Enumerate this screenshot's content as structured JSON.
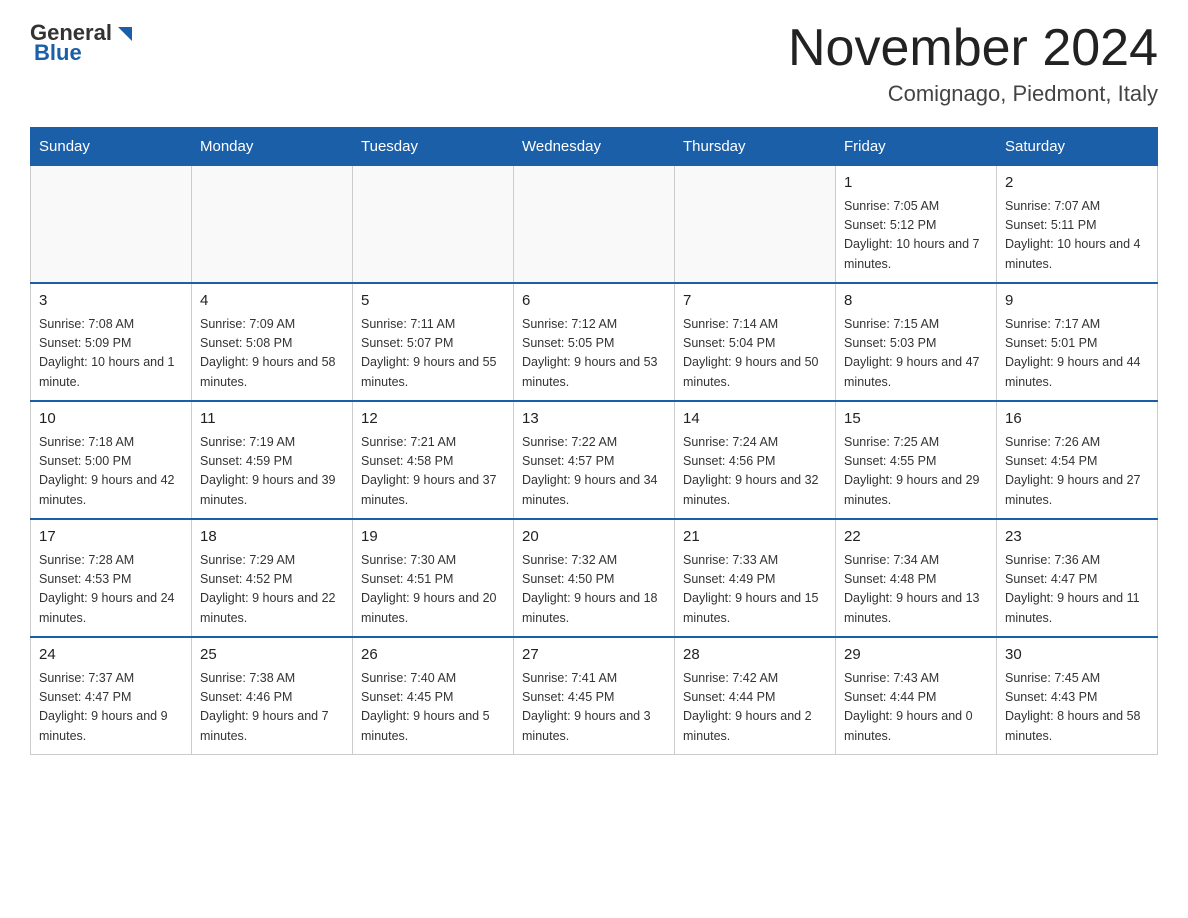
{
  "header": {
    "logo_general": "General",
    "logo_blue": "Blue",
    "month_title": "November 2024",
    "location": "Comignago, Piedmont, Italy"
  },
  "weekdays": [
    "Sunday",
    "Monday",
    "Tuesday",
    "Wednesday",
    "Thursday",
    "Friday",
    "Saturday"
  ],
  "weeks": [
    [
      {
        "day": "",
        "info": ""
      },
      {
        "day": "",
        "info": ""
      },
      {
        "day": "",
        "info": ""
      },
      {
        "day": "",
        "info": ""
      },
      {
        "day": "",
        "info": ""
      },
      {
        "day": "1",
        "info": "Sunrise: 7:05 AM\nSunset: 5:12 PM\nDaylight: 10 hours and 7 minutes."
      },
      {
        "day": "2",
        "info": "Sunrise: 7:07 AM\nSunset: 5:11 PM\nDaylight: 10 hours and 4 minutes."
      }
    ],
    [
      {
        "day": "3",
        "info": "Sunrise: 7:08 AM\nSunset: 5:09 PM\nDaylight: 10 hours and 1 minute."
      },
      {
        "day": "4",
        "info": "Sunrise: 7:09 AM\nSunset: 5:08 PM\nDaylight: 9 hours and 58 minutes."
      },
      {
        "day": "5",
        "info": "Sunrise: 7:11 AM\nSunset: 5:07 PM\nDaylight: 9 hours and 55 minutes."
      },
      {
        "day": "6",
        "info": "Sunrise: 7:12 AM\nSunset: 5:05 PM\nDaylight: 9 hours and 53 minutes."
      },
      {
        "day": "7",
        "info": "Sunrise: 7:14 AM\nSunset: 5:04 PM\nDaylight: 9 hours and 50 minutes."
      },
      {
        "day": "8",
        "info": "Sunrise: 7:15 AM\nSunset: 5:03 PM\nDaylight: 9 hours and 47 minutes."
      },
      {
        "day": "9",
        "info": "Sunrise: 7:17 AM\nSunset: 5:01 PM\nDaylight: 9 hours and 44 minutes."
      }
    ],
    [
      {
        "day": "10",
        "info": "Sunrise: 7:18 AM\nSunset: 5:00 PM\nDaylight: 9 hours and 42 minutes."
      },
      {
        "day": "11",
        "info": "Sunrise: 7:19 AM\nSunset: 4:59 PM\nDaylight: 9 hours and 39 minutes."
      },
      {
        "day": "12",
        "info": "Sunrise: 7:21 AM\nSunset: 4:58 PM\nDaylight: 9 hours and 37 minutes."
      },
      {
        "day": "13",
        "info": "Sunrise: 7:22 AM\nSunset: 4:57 PM\nDaylight: 9 hours and 34 minutes."
      },
      {
        "day": "14",
        "info": "Sunrise: 7:24 AM\nSunset: 4:56 PM\nDaylight: 9 hours and 32 minutes."
      },
      {
        "day": "15",
        "info": "Sunrise: 7:25 AM\nSunset: 4:55 PM\nDaylight: 9 hours and 29 minutes."
      },
      {
        "day": "16",
        "info": "Sunrise: 7:26 AM\nSunset: 4:54 PM\nDaylight: 9 hours and 27 minutes."
      }
    ],
    [
      {
        "day": "17",
        "info": "Sunrise: 7:28 AM\nSunset: 4:53 PM\nDaylight: 9 hours and 24 minutes."
      },
      {
        "day": "18",
        "info": "Sunrise: 7:29 AM\nSunset: 4:52 PM\nDaylight: 9 hours and 22 minutes."
      },
      {
        "day": "19",
        "info": "Sunrise: 7:30 AM\nSunset: 4:51 PM\nDaylight: 9 hours and 20 minutes."
      },
      {
        "day": "20",
        "info": "Sunrise: 7:32 AM\nSunset: 4:50 PM\nDaylight: 9 hours and 18 minutes."
      },
      {
        "day": "21",
        "info": "Sunrise: 7:33 AM\nSunset: 4:49 PM\nDaylight: 9 hours and 15 minutes."
      },
      {
        "day": "22",
        "info": "Sunrise: 7:34 AM\nSunset: 4:48 PM\nDaylight: 9 hours and 13 minutes."
      },
      {
        "day": "23",
        "info": "Sunrise: 7:36 AM\nSunset: 4:47 PM\nDaylight: 9 hours and 11 minutes."
      }
    ],
    [
      {
        "day": "24",
        "info": "Sunrise: 7:37 AM\nSunset: 4:47 PM\nDaylight: 9 hours and 9 minutes."
      },
      {
        "day": "25",
        "info": "Sunrise: 7:38 AM\nSunset: 4:46 PM\nDaylight: 9 hours and 7 minutes."
      },
      {
        "day": "26",
        "info": "Sunrise: 7:40 AM\nSunset: 4:45 PM\nDaylight: 9 hours and 5 minutes."
      },
      {
        "day": "27",
        "info": "Sunrise: 7:41 AM\nSunset: 4:45 PM\nDaylight: 9 hours and 3 minutes."
      },
      {
        "day": "28",
        "info": "Sunrise: 7:42 AM\nSunset: 4:44 PM\nDaylight: 9 hours and 2 minutes."
      },
      {
        "day": "29",
        "info": "Sunrise: 7:43 AM\nSunset: 4:44 PM\nDaylight: 9 hours and 0 minutes."
      },
      {
        "day": "30",
        "info": "Sunrise: 7:45 AM\nSunset: 4:43 PM\nDaylight: 8 hours and 58 minutes."
      }
    ]
  ]
}
